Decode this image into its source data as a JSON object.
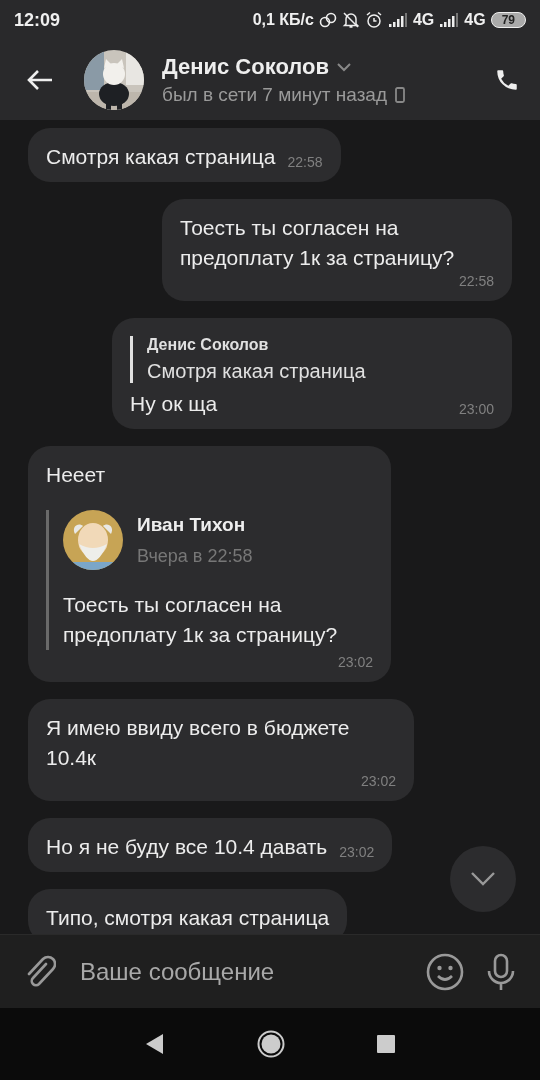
{
  "status_bar": {
    "time": "12:09",
    "speed": "0,1 КБ/с",
    "network_1": "4G",
    "network_2": "4G",
    "battery": "79"
  },
  "header": {
    "name": "Денис Соколов",
    "status": "был в сети 7 минут назад"
  },
  "messages": [
    {
      "kind": "in",
      "text": "Смотря какая страница",
      "time": "22:58"
    },
    {
      "kind": "out",
      "text": "Тоесть ты согласен на предоплату 1к за страницу?",
      "time": "22:58"
    },
    {
      "kind": "out",
      "reply": {
        "author": "Денис Соколов",
        "text": "Смотря какая страница"
      },
      "text": "Ну ок ща",
      "time": "23:00"
    },
    {
      "kind": "in",
      "text": "Нееет",
      "forward": {
        "author": "Иван Тихон",
        "date": "Вчера в 22:58",
        "text": "Тоесть ты согласен на предоплату 1к за страницу?"
      },
      "time": "23:02"
    },
    {
      "kind": "in",
      "text": "Я имею ввиду всего в бюджете 10.4к",
      "time": "23:02"
    },
    {
      "kind": "in",
      "text": "Но я не буду все 10.4 давать",
      "time": "23:02"
    },
    {
      "kind": "in",
      "text": "Типо, смотря какая страница"
    }
  ],
  "composer": {
    "placeholder": "Ваше сообщение"
  }
}
